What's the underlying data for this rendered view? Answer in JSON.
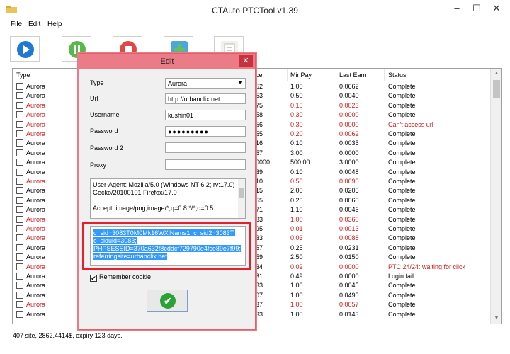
{
  "window": {
    "title": "CTAuto PTCTool v1.39",
    "minimize": "–",
    "maximize": "☐",
    "close": "✕"
  },
  "menu": [
    "File",
    "Edit",
    "Help"
  ],
  "grid": {
    "columns": {
      "type": "Type",
      "price": "ce",
      "minpay": "MinPay",
      "last_earn": "Last Earn",
      "status": "Status"
    },
    "rows": [
      {
        "type": "Aurora",
        "red": false,
        "price": "52",
        "minpay": "1.00",
        "last_earn": "0.0662",
        "status": "Complete"
      },
      {
        "type": "Aurora",
        "red": false,
        "price": "53",
        "minpay": "0.50",
        "last_earn": "0.0040",
        "status": "Complete"
      },
      {
        "type": "Aurora",
        "red": true,
        "price": "75",
        "minpay": "0.10",
        "last_earn": "0.0023",
        "status": "Complete"
      },
      {
        "type": "Aurora",
        "red": true,
        "price": "58",
        "minpay": "0.30",
        "last_earn": "0.0000",
        "status": "Complete"
      },
      {
        "type": "Aurora",
        "red": true,
        "price": "56",
        "minpay": "0.30",
        "last_earn": "0.0000",
        "status": "Can't access url"
      },
      {
        "type": "Aurora",
        "red": true,
        "price": "55",
        "minpay": "0.20",
        "last_earn": "0.0062",
        "status": "Complete"
      },
      {
        "type": "Aurora",
        "red": false,
        "price": "16",
        "minpay": "0.10",
        "last_earn": "0.0035",
        "status": "Complete"
      },
      {
        "type": "Aurora",
        "red": false,
        "price": "57",
        "minpay": "3.00",
        "last_earn": "0.0000",
        "status": "Complete"
      },
      {
        "type": "Aurora",
        "red": false,
        "price": "0000",
        "minpay": "500.00",
        "last_earn": "3.0000",
        "status": "Complete"
      },
      {
        "type": "Aurora",
        "red": false,
        "price": "39",
        "minpay": "0.10",
        "last_earn": "0.0048",
        "status": "Complete"
      },
      {
        "type": "Aurora",
        "red": true,
        "price": "10",
        "minpay": "0.50",
        "last_earn": "0.0690",
        "status": "Complete"
      },
      {
        "type": "Aurora",
        "red": false,
        "price": "15",
        "minpay": "2.00",
        "last_earn": "0.0205",
        "status": "Complete"
      },
      {
        "type": "Aurora",
        "red": false,
        "price": "55",
        "minpay": "0.25",
        "last_earn": "0.0060",
        "status": "Complete"
      },
      {
        "type": "Aurora",
        "red": false,
        "price": "71",
        "minpay": "1.10",
        "last_earn": "0.0046",
        "status": "Complete"
      },
      {
        "type": "Aurora",
        "red": true,
        "price": "33",
        "minpay": "1.00",
        "last_earn": "0.0360",
        "status": "Complete"
      },
      {
        "type": "Aurora",
        "red": true,
        "price": "95",
        "minpay": "0.01",
        "last_earn": "0.0013",
        "status": "Complete"
      },
      {
        "type": "Aurora",
        "red": true,
        "price": "33",
        "minpay": "0.03",
        "last_earn": "0.0088",
        "status": "Complete"
      },
      {
        "type": "Aurora",
        "red": false,
        "price": "57",
        "minpay": "0.25",
        "last_earn": "0.0231",
        "status": "Complete"
      },
      {
        "type": "Aurora",
        "red": false,
        "price": "59",
        "minpay": "2.50",
        "last_earn": "0.0150",
        "status": "Complete"
      },
      {
        "type": "Aurora",
        "red": true,
        "price": "34",
        "minpay": "0.02",
        "last_earn": "0.0000",
        "status": "PTC 24/24: waiting for click",
        "status_red": true
      },
      {
        "type": "Aurora",
        "red": false,
        "price": "31",
        "minpay": "0.49",
        "last_earn": "0.0000",
        "status": "Login fail"
      },
      {
        "type": "Aurora",
        "red": false,
        "price": "33",
        "minpay": "1.00",
        "last_earn": "0.0045",
        "status": "Complete"
      },
      {
        "type": "Aurora",
        "red": false,
        "price": "07",
        "minpay": "1.00",
        "last_earn": "0.0490",
        "status": "Complete"
      },
      {
        "type": "Aurora",
        "red": true,
        "price": "37",
        "minpay": "1.00",
        "last_earn": "0.0057",
        "status": "Complete"
      },
      {
        "type": "Aurora",
        "red": false,
        "price": "33",
        "minpay": "1.00",
        "last_earn": "0.0143",
        "status": "Complete"
      }
    ]
  },
  "status_bar": "407 site, 2862.4414$, expiry 123 days.",
  "dialog": {
    "title": "Edit",
    "close": "✕",
    "labels": {
      "type": "Type",
      "url": "Url",
      "username": "Username",
      "password": "Password",
      "password2": "Password 2",
      "proxy": "Proxy"
    },
    "values": {
      "type": "Aurora",
      "url": "http://urbanclix.net",
      "username": "kushin01",
      "password": "●●●●●●●●●",
      "password2": "",
      "proxy": ""
    },
    "headers_text": [
      "User-Agent: Mozilla/5.0 (Windows NT 6.2; rv:17.0)",
      "Gecko/20100101 Firefox/17.0",
      "",
      "Accept: image/png,image/*;q=0.8,*/*;q=0.5"
    ],
    "cookie_text": [
      "c_sid=3083T0M0Mk16WXlNams1; c_sid2=3083T;",
      "c_siduid=3083;",
      "PHPSESSID=370a632f8cddcf729790e4fce89e7f99;",
      "referringsite=urbanclix.net"
    ],
    "remember_cookie": "Remember cookie",
    "remember_checked": "✔",
    "ok": "✔"
  }
}
